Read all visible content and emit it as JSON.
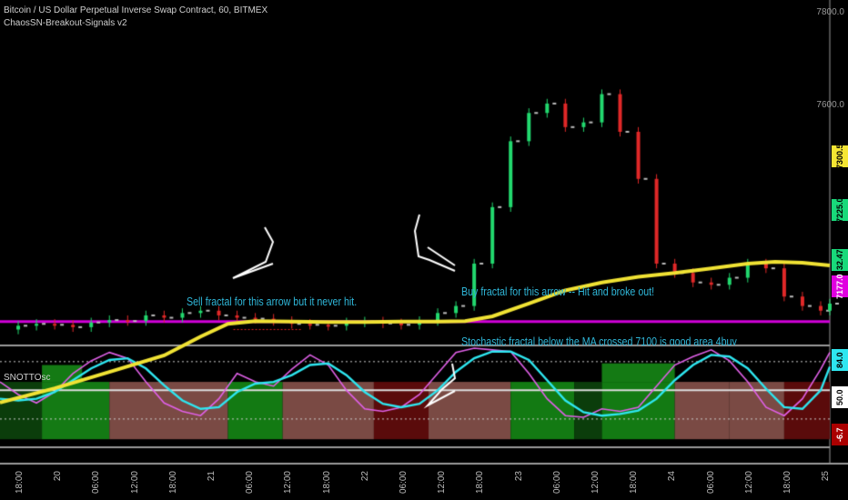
{
  "header": {
    "title": "Bitcoin / US Dollar Perpetual Inverse Swap Contract, 60, BITMEX",
    "indicator": "ChaosSN-Breakout-Signals v2"
  },
  "oscillator": {
    "label": "SNOTTOsc"
  },
  "annotations": {
    "sell": "Sell fractal for this arrow but it never hit.",
    "buy": "Buy fractal for this arrow -- Hit and broke out!",
    "note": "Stochastic fractal below the MA crossed 7100 is good area 4buy"
  },
  "price_axis": {
    "ticks": [
      "7800.0",
      "7600.0",
      "7300.5",
      "7225.0",
      "7177.0"
    ],
    "badges": [
      {
        "text": "7300.5",
        "color": "#f5e533",
        "text_color": "#000000"
      },
      {
        "text": "7225.0",
        "color": "#18d97a",
        "text_color": "#000000"
      },
      {
        "text": "32.47",
        "color": "#18d97a",
        "text_color": "#000000"
      },
      {
        "text": "7177.0",
        "color": "#e000e0",
        "text_color": "#ffffff"
      }
    ]
  },
  "osc_axis": {
    "badges": [
      {
        "text": "84.0",
        "color": "#2ee6f0",
        "text_color": "#000000"
      },
      {
        "text": "50.0",
        "color": "#ffffff",
        "text_color": "#000000"
      },
      {
        "text": "-6.7",
        "color": "#aa0000",
        "text_color": "#ffffff"
      }
    ]
  },
  "x_axis": {
    "ticks": [
      "18:00",
      "20",
      "06:00",
      "12:00",
      "18:00",
      "21",
      "06:00",
      "12:00",
      "18:00",
      "22",
      "06:00",
      "12:00",
      "18:00",
      "23",
      "06:00",
      "12:00",
      "18:00",
      "24",
      "06:00",
      "12:00",
      "18:00",
      "25"
    ]
  },
  "chart_data": {
    "type": "line",
    "price": {
      "ylim": [
        7130,
        7860
      ],
      "support_line": 7177,
      "sell_fractal_level": 7160,
      "moving_average": [
        [
          0,
          7005
        ],
        [
          3,
          7035
        ],
        [
          6,
          7070
        ],
        [
          9,
          7105
        ],
        [
          11,
          7145
        ],
        [
          12.5,
          7172
        ],
        [
          14,
          7178
        ],
        [
          16,
          7177
        ],
        [
          18,
          7176
        ],
        [
          20,
          7176
        ],
        [
          22,
          7177
        ],
        [
          24,
          7177
        ],
        [
          25.5,
          7178
        ],
        [
          27,
          7188
        ],
        [
          29,
          7215
        ],
        [
          31,
          7243
        ],
        [
          33,
          7260
        ],
        [
          35,
          7272
        ],
        [
          37,
          7280
        ],
        [
          39,
          7290
        ],
        [
          41,
          7300
        ],
        [
          42.5,
          7304
        ],
        [
          44,
          7302
        ],
        [
          45.5,
          7296
        ]
      ],
      "candles_close": [
        [
          0,
          7160
        ],
        [
          1,
          7168
        ],
        [
          2,
          7172
        ],
        [
          3,
          7170
        ],
        [
          4,
          7165
        ],
        [
          5,
          7175
        ],
        [
          6,
          7180
        ],
        [
          7,
          7178
        ],
        [
          8,
          7190
        ],
        [
          9,
          7185
        ],
        [
          10,
          7195
        ],
        [
          11,
          7200
        ],
        [
          12,
          7190
        ],
        [
          13,
          7185
        ],
        [
          14,
          7183
        ],
        [
          15,
          7178
        ],
        [
          16,
          7172
        ],
        [
          17,
          7170
        ],
        [
          18,
          7168
        ],
        [
          19,
          7175
        ],
        [
          20,
          7177
        ],
        [
          21,
          7173
        ],
        [
          22,
          7170
        ],
        [
          23,
          7178
        ],
        [
          24,
          7195
        ],
        [
          25,
          7210
        ],
        [
          26,
          7300
        ],
        [
          27,
          7420
        ],
        [
          28,
          7560
        ],
        [
          29,
          7620
        ],
        [
          30,
          7640
        ],
        [
          31,
          7590
        ],
        [
          32,
          7600
        ],
        [
          33,
          7660
        ],
        [
          34,
          7580
        ],
        [
          35,
          7480
        ],
        [
          36,
          7300
        ],
        [
          37,
          7280
        ],
        [
          38,
          7260
        ],
        [
          39,
          7255
        ],
        [
          40,
          7270
        ],
        [
          41,
          7300
        ],
        [
          42,
          7290
        ],
        [
          43,
          7230
        ],
        [
          44,
          7210
        ],
        [
          45,
          7200
        ],
        [
          45.5,
          7215
        ]
      ]
    },
    "oscillator": {
      "ylim": [
        -10,
        100
      ],
      "levels": [
        84,
        50,
        16
      ],
      "fast": [
        [
          0,
          60
        ],
        [
          1,
          45
        ],
        [
          2,
          35
        ],
        [
          3,
          48
        ],
        [
          4,
          70
        ],
        [
          5,
          85
        ],
        [
          6,
          95
        ],
        [
          7,
          88
        ],
        [
          8,
          60
        ],
        [
          9,
          35
        ],
        [
          10,
          25
        ],
        [
          11,
          20
        ],
        [
          12,
          40
        ],
        [
          13,
          70
        ],
        [
          14,
          60
        ],
        [
          15,
          55
        ],
        [
          16,
          75
        ],
        [
          17,
          92
        ],
        [
          18,
          80
        ],
        [
          19,
          50
        ],
        [
          20,
          28
        ],
        [
          21,
          25
        ],
        [
          22,
          30
        ],
        [
          23,
          45
        ],
        [
          24,
          70
        ],
        [
          25,
          95
        ],
        [
          26,
          100
        ],
        [
          27,
          98
        ],
        [
          28,
          96
        ],
        [
          29,
          70
        ],
        [
          30,
          40
        ],
        [
          31,
          20
        ],
        [
          32,
          18
        ],
        [
          33,
          28
        ],
        [
          34,
          25
        ],
        [
          35,
          30
        ],
        [
          36,
          55
        ],
        [
          37,
          80
        ],
        [
          38,
          90
        ],
        [
          39,
          98
        ],
        [
          40,
          85
        ],
        [
          41,
          60
        ],
        [
          42,
          30
        ],
        [
          43,
          20
        ],
        [
          44,
          40
        ],
        [
          45,
          75
        ],
        [
          45.5,
          95
        ]
      ],
      "slow": [
        [
          0,
          40
        ],
        [
          1,
          38
        ],
        [
          2,
          40
        ],
        [
          3,
          48
        ],
        [
          4,
          62
        ],
        [
          5,
          76
        ],
        [
          6,
          86
        ],
        [
          7,
          88
        ],
        [
          8,
          76
        ],
        [
          9,
          56
        ],
        [
          10,
          38
        ],
        [
          11,
          28
        ],
        [
          12,
          30
        ],
        [
          13,
          48
        ],
        [
          14,
          58
        ],
        [
          15,
          60
        ],
        [
          16,
          68
        ],
        [
          17,
          80
        ],
        [
          18,
          82
        ],
        [
          19,
          68
        ],
        [
          20,
          48
        ],
        [
          21,
          34
        ],
        [
          22,
          30
        ],
        [
          23,
          34
        ],
        [
          24,
          50
        ],
        [
          25,
          72
        ],
        [
          26,
          88
        ],
        [
          27,
          96
        ],
        [
          28,
          96
        ],
        [
          29,
          86
        ],
        [
          30,
          62
        ],
        [
          31,
          38
        ],
        [
          32,
          24
        ],
        [
          33,
          20
        ],
        [
          34,
          22
        ],
        [
          35,
          26
        ],
        [
          36,
          40
        ],
        [
          37,
          62
        ],
        [
          38,
          80
        ],
        [
          39,
          92
        ],
        [
          40,
          90
        ],
        [
          41,
          76
        ],
        [
          42,
          52
        ],
        [
          43,
          30
        ],
        [
          44,
          28
        ],
        [
          45,
          50
        ],
        [
          45.5,
          78
        ]
      ]
    }
  }
}
